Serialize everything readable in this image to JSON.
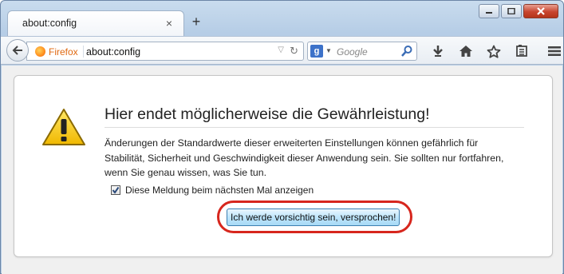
{
  "tab": {
    "title": "about:config",
    "close": "×"
  },
  "new_tab": "+",
  "navbar": {
    "identity_label": "Firefox",
    "url": "about:config",
    "search_placeholder": "Google",
    "search_engine_letter": "g"
  },
  "dialog": {
    "title": "Hier endet möglicherweise die Gewährleistung!",
    "description": "Änderungen der Standardwerte dieser erweiterten Einstellungen können gefährlich für Stabilität, Sicherheit und Geschwindigkeit dieser Anwendung sein. Sie sollten nur fortfahren, wenn Sie genau wissen, was Sie tun.",
    "checkbox_label": "Diese Meldung beim nächsten Mal anzeigen",
    "checkbox_checked": true,
    "confirm_button": "Ich werde vorsichtig sein, versprochen!"
  },
  "colors": {
    "highlight": "#d7261d",
    "warning_yellow": "#f5c400",
    "identity_orange": "#e06a12"
  }
}
